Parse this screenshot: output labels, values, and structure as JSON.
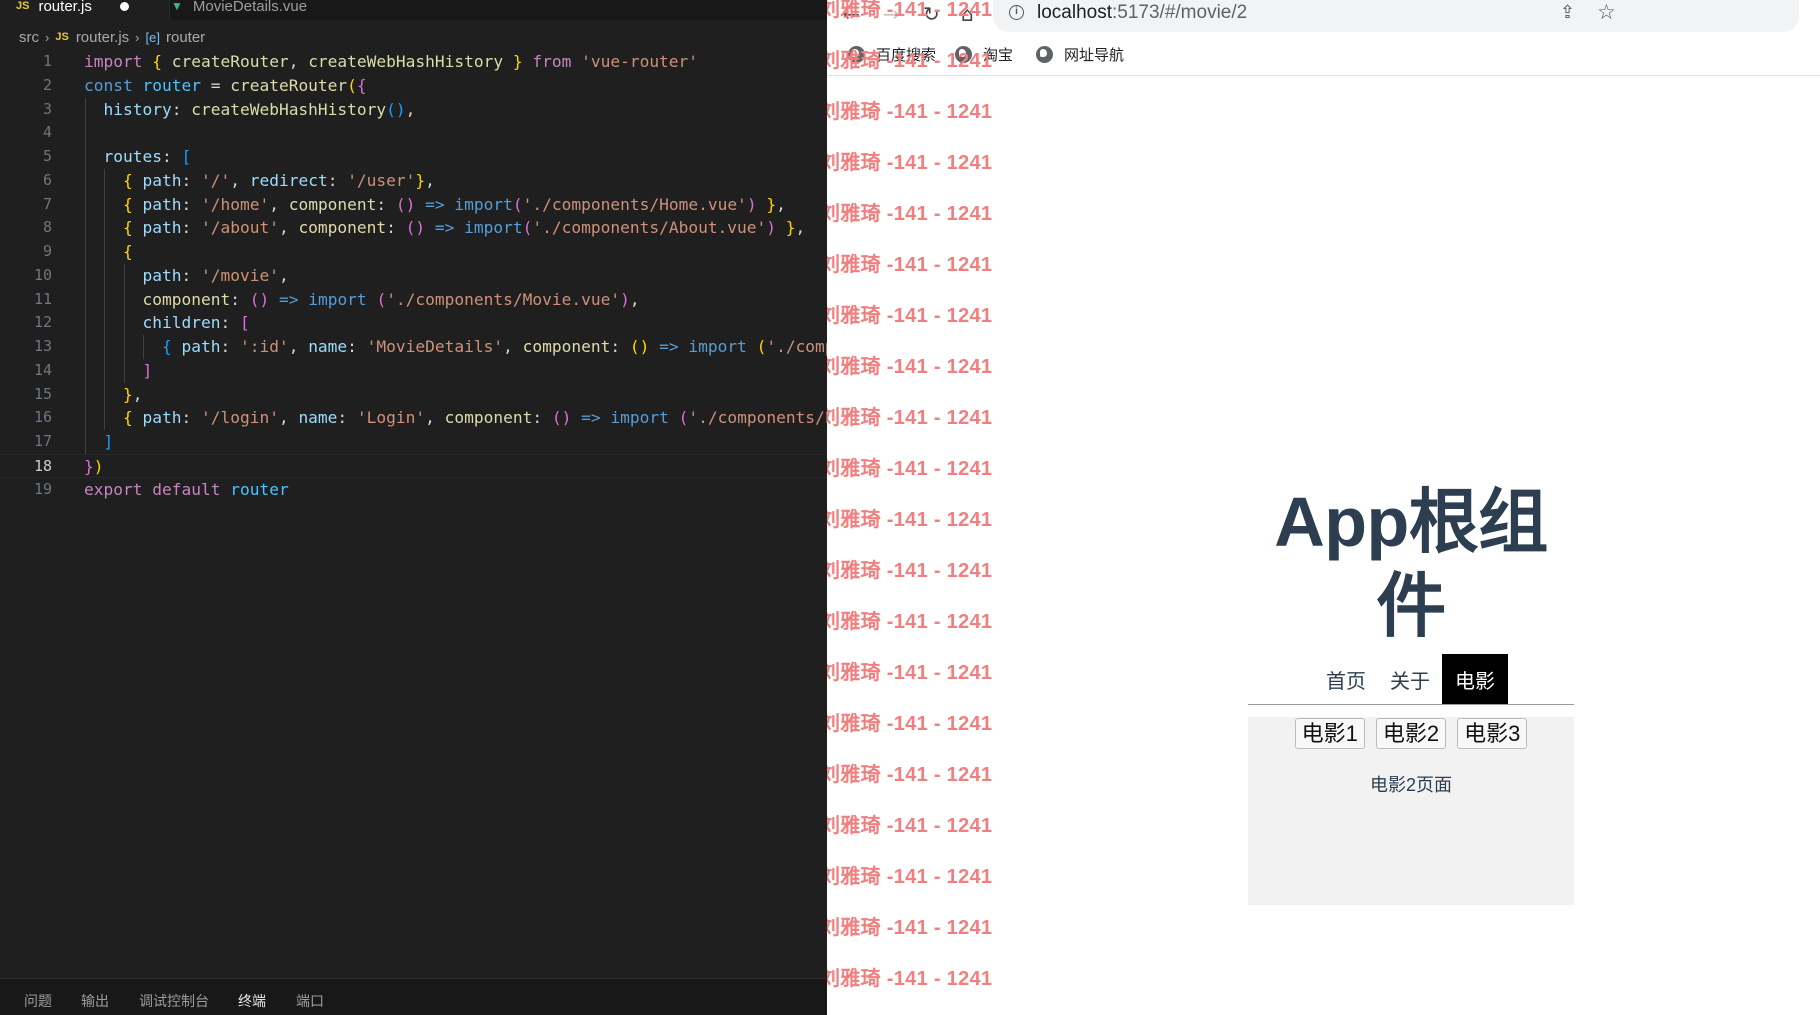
{
  "editor": {
    "tabs": [
      {
        "icon": "JS",
        "label": "router.js"
      },
      {
        "icon": "▼",
        "label": "MovieDetails.vue"
      }
    ],
    "breadcrumb": {
      "folder": "src",
      "file_icon": "JS",
      "file": "router.js",
      "symbol_icon": "[e]",
      "symbol": "router"
    },
    "line_numbers": [
      "1",
      "2",
      "3",
      "4",
      "5",
      "6",
      "7",
      "8",
      "9",
      "10",
      "11",
      "12",
      "13",
      "14",
      "15",
      "16",
      "17",
      "18",
      "19"
    ],
    "panel_tabs": [
      "问题",
      "输出",
      "调试控制台",
      "终端",
      "端口"
    ],
    "active_panel_tab": "终端"
  },
  "browser": {
    "url_host": "localhost",
    "url_path": ":5173/#/movie/2",
    "bookmarks": [
      "百度搜索",
      "淘宝",
      "网址导航"
    ],
    "watermark_text": "刘雅琦 -141 - 1241"
  },
  "app": {
    "title": "App根组件",
    "nav": [
      "首页",
      "关于",
      "电影"
    ],
    "active_nav": "电影",
    "movies": [
      "电影1",
      "电影2",
      "电影3"
    ],
    "detail": "电影2页面"
  }
}
